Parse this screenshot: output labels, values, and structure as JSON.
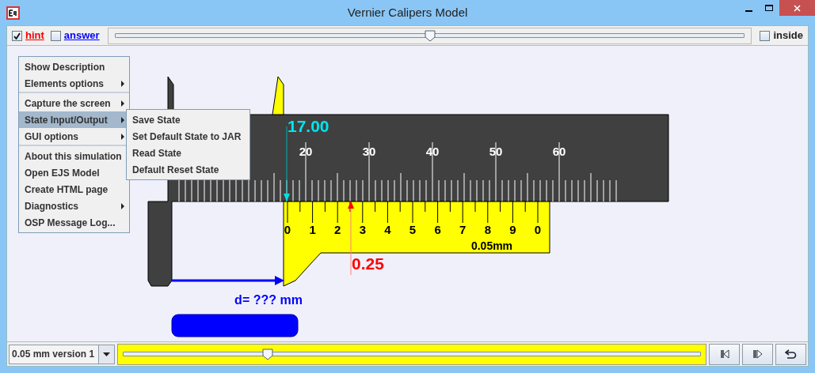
{
  "window": {
    "title": "Vernier Calipers Model"
  },
  "toolbar": {
    "hint": {
      "label": "hint",
      "checked": true
    },
    "answer": {
      "label": "answer",
      "checked": false
    },
    "slider": {
      "level": 0.5
    },
    "inside": {
      "label": "inside",
      "checked": false
    }
  },
  "menu": {
    "sections": [
      [
        {
          "label": "Show Description",
          "has_submenu": false,
          "selected": false
        },
        {
          "label": "Elements options",
          "has_submenu": true,
          "selected": false
        }
      ],
      [
        {
          "label": "Capture the screen",
          "has_submenu": true,
          "selected": false
        },
        {
          "label": "State Input/Output",
          "has_submenu": true,
          "selected": true
        },
        {
          "label": "GUI options",
          "has_submenu": true,
          "selected": false
        }
      ],
      [
        {
          "label": "About this simulation",
          "has_submenu": false,
          "selected": false
        },
        {
          "label": "Open EJS Model",
          "has_submenu": false,
          "selected": false
        },
        {
          "label": "Create HTML page",
          "has_submenu": false,
          "selected": false
        },
        {
          "label": "Diagnostics",
          "has_submenu": true,
          "selected": false
        },
        {
          "label": "OSP Message Log...",
          "has_submenu": false,
          "selected": false
        }
      ]
    ],
    "submenu": [
      "Save State",
      "Set Default State to JAR",
      "Read State",
      "Default Reset State"
    ]
  },
  "caliper": {
    "main_scale_labels": [
      "20",
      "30",
      "40",
      "50",
      "60"
    ],
    "vernier_labels": [
      "0",
      "1",
      "2",
      "3",
      "4",
      "5",
      "6",
      "7",
      "8",
      "9",
      "0"
    ],
    "main_reading": "17.00",
    "vernier_reading": "0.25",
    "resolution_label": "0.05mm",
    "distance_label": "d= ??? mm"
  },
  "bottom_bar": {
    "version_select": "0.05 mm version 1",
    "slider": {
      "level": 0.25
    }
  }
}
